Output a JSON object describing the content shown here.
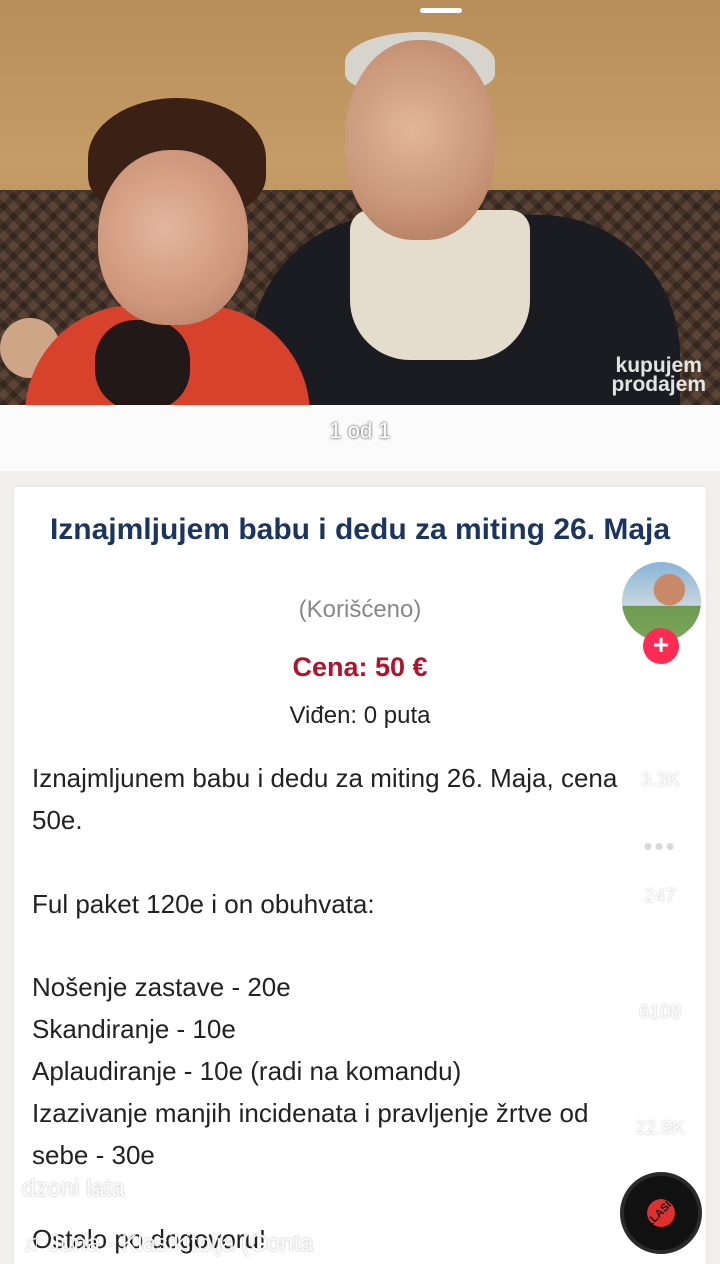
{
  "photo": {
    "watermark_line1": "kupujem",
    "watermark_line2": "prodajem"
  },
  "gallery": {
    "counter": "1 od 1"
  },
  "listing": {
    "title": "Iznajmljujem babu i dedu za miting 26. Maja",
    "condition": "(Korišćeno)",
    "price": "Cena: 50 €",
    "views": "Viđen: 0 puta",
    "description_lines": [
      "Iznajmljunem babu i dedu za miting 26. Maja, cena",
      "50e.",
      "Ful paket 120e i on obuhvata:",
      "Nošenje zastave - 20e",
      "Skandiranje - 10e",
      "Aplaudiranje - 10e (radi na komandu)",
      "Izazivanje manjih incidenata i pravljenje žrtve od",
      "sebe - 30e",
      "Ostalo po dogovoru!"
    ]
  },
  "sidebar": {
    "likes": "3.3K",
    "comments": "247",
    "saves": "6108",
    "shares": "22.9K",
    "follow_symbol": "+"
  },
  "video": {
    "author": "dzoni lata",
    "music": "Juna - Klasikitoija (Conta",
    "record_label": "KLASIK"
  },
  "colors": {
    "title": "#1c3560",
    "price": "#b0132b",
    "follow": "#fe2c55"
  }
}
